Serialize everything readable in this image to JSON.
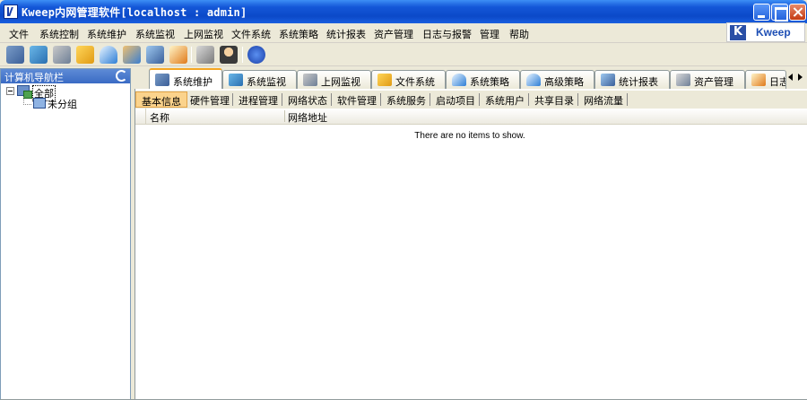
{
  "window": {
    "title": "Kweep内网管理软件[localhost : admin]",
    "buttons": [
      "minimize",
      "maximize",
      "close"
    ]
  },
  "menu": {
    "items": [
      "文件",
      "系统控制",
      "系统维护",
      "系统监视",
      "上网监视",
      "文件系统",
      "系统策略",
      "统计报表",
      "资产管理",
      "日志与报警",
      "管理",
      "帮助"
    ]
  },
  "brand": {
    "text": "Kweep",
    "icon": "kweep-logo-icon"
  },
  "toolbar": {
    "icons": [
      "system-maintenance-icon",
      "system-monitor-icon",
      "web-monitor-icon",
      "file-system-icon",
      "system-policy-icon",
      "advanced-policy-icon",
      "statistics-icon",
      "asset-icon",
      "log-alarm-icon",
      "database-icon",
      "user-admin-icon",
      "help-icon"
    ]
  },
  "nav": {
    "title": "计算机导航栏",
    "refresh_icon": "refresh-icon",
    "tree": {
      "root": "全部",
      "children": [
        "未分组"
      ]
    }
  },
  "tabs": [
    {
      "label": "系统维护",
      "icon": "system-maintenance-icon",
      "active": true
    },
    {
      "label": "系统监视",
      "icon": "system-monitor-icon"
    },
    {
      "label": "上网监视",
      "icon": "web-monitor-icon"
    },
    {
      "label": "文件系统",
      "icon": "file-system-icon"
    },
    {
      "label": "系统策略",
      "icon": "system-policy-icon"
    },
    {
      "label": "高级策略",
      "icon": "advanced-policy-icon"
    },
    {
      "label": "统计报表",
      "icon": "statistics-icon"
    },
    {
      "label": "资产管理",
      "icon": "asset-icon"
    },
    {
      "label": "日志",
      "icon": "log-alarm-icon"
    }
  ],
  "subtabs": [
    "基本信息",
    "硬件管理",
    "进程管理",
    "网络状态",
    "软件管理",
    "系统服务",
    "启动项目",
    "系统用户",
    "共享目录",
    "网络流量"
  ],
  "list": {
    "columns": [
      "名称",
      "网络地址"
    ],
    "empty_message": "There are no items to show."
  },
  "colors": {
    "titlebar": "#0b49c8",
    "active_subtab": "#fbd38c",
    "active_tab_accent": "#f5a623",
    "nav_header": "#3a6bc4"
  }
}
